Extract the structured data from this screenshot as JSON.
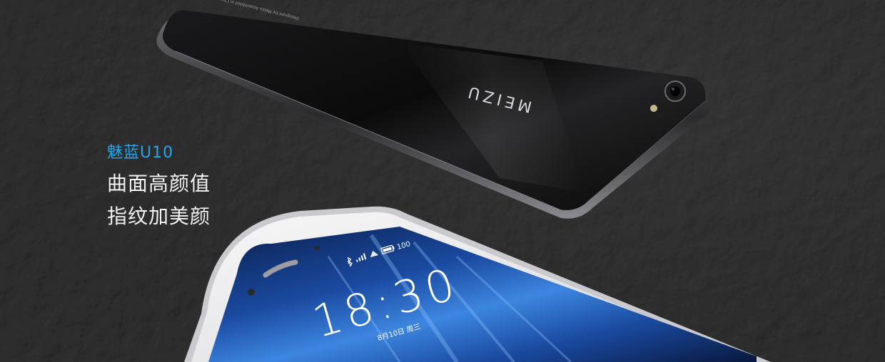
{
  "headline": {
    "model": "魅蓝U10",
    "line1": "曲面高颜值",
    "line2": "指纹加美颜"
  },
  "back_phone": {
    "brand_logo": "MEIZU",
    "back_fine_print": "Designed by Meizu  Assembled in China"
  },
  "front_phone": {
    "status_battery": "100",
    "clock_time": "18:30",
    "clock_date": "8月10日 周三"
  },
  "colors": {
    "accent": "#29a3ea",
    "headline_text": "#f2f2f2",
    "background": "#1c1c1c",
    "back_phone_body": "#0a0a0a",
    "front_phone_body": "#e9e9ea",
    "screen_blue": "#1f5db8"
  },
  "icons": [
    "bluetooth-icon",
    "signal-icon",
    "wifi-icon",
    "battery-icon",
    "camera-lens-icon",
    "flash-icon",
    "speaker-grille-icon",
    "front-camera-icon",
    "proximity-sensor-icon"
  ]
}
